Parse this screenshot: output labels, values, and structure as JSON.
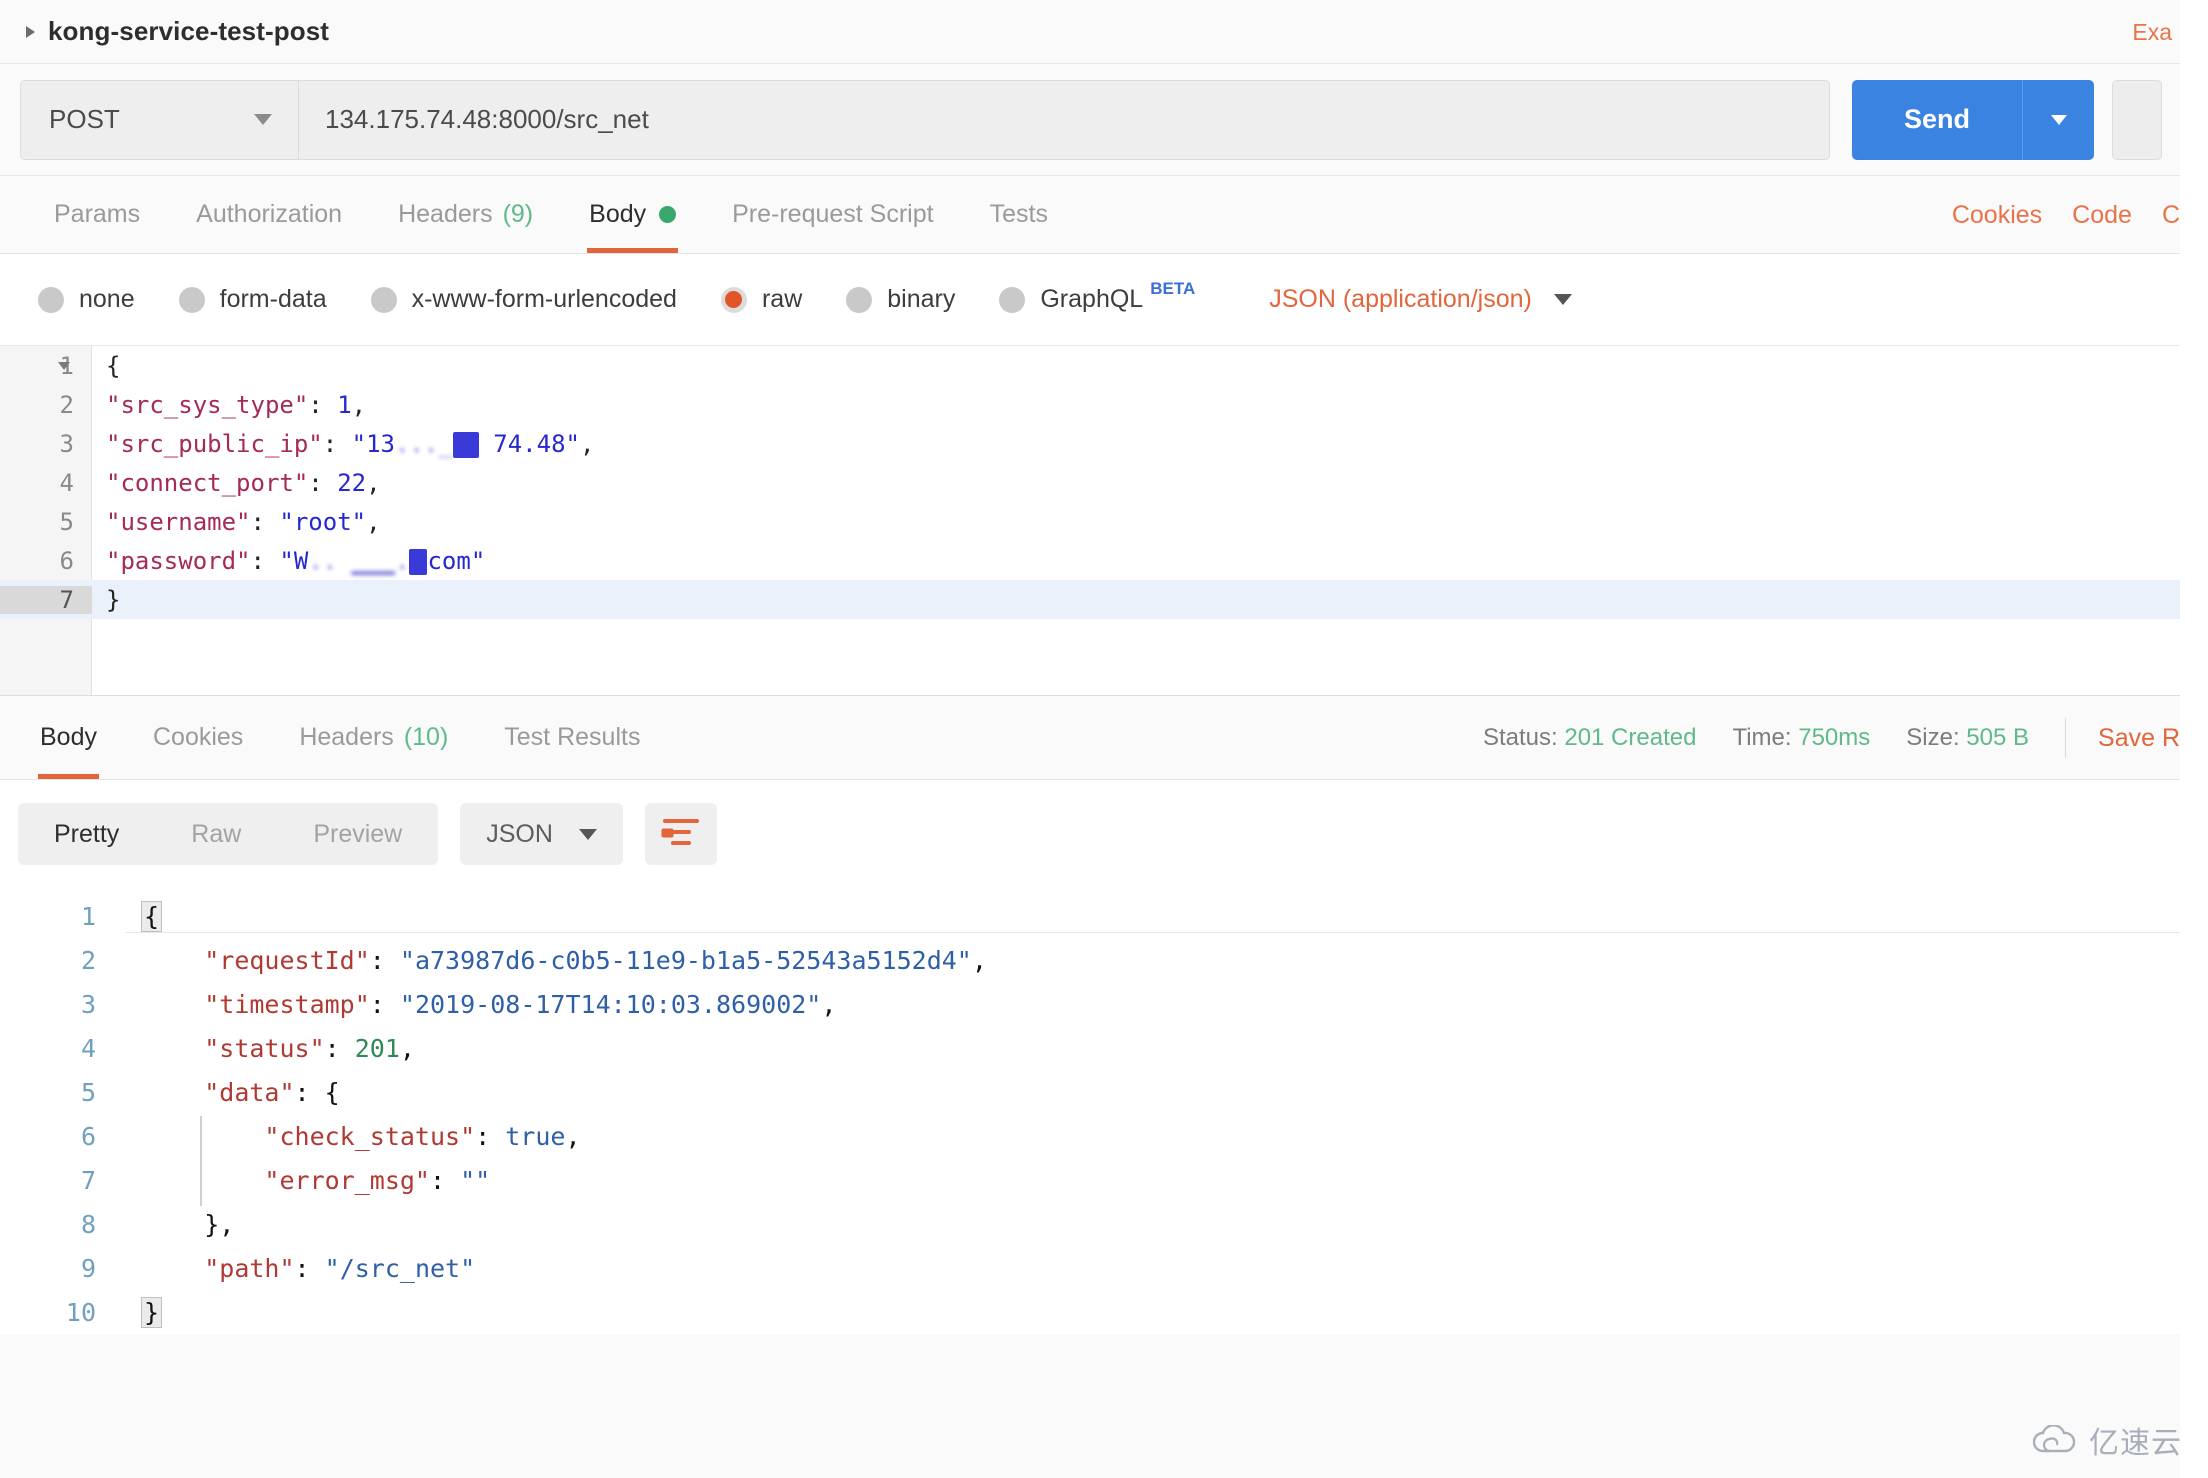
{
  "request": {
    "name": "kong-service-test-post",
    "examples_link": "Exa",
    "method": "POST",
    "url": "134.175.74.48:8000/src_net",
    "send_label": "Send",
    "tabs": [
      {
        "label": "Params",
        "count": "",
        "active": false,
        "dot": false
      },
      {
        "label": "Authorization",
        "count": "",
        "active": false,
        "dot": false
      },
      {
        "label": "Headers",
        "count": "(9)",
        "active": false,
        "dot": false
      },
      {
        "label": "Body",
        "count": "",
        "active": true,
        "dot": true
      },
      {
        "label": "Pre-request Script",
        "count": "",
        "active": false,
        "dot": false
      },
      {
        "label": "Tests",
        "count": "",
        "active": false,
        "dot": false
      }
    ],
    "right_links": [
      "Cookies",
      "Code",
      "C"
    ],
    "body_types": [
      {
        "label": "none",
        "checked": false
      },
      {
        "label": "form-data",
        "checked": false
      },
      {
        "label": "x-www-form-urlencoded",
        "checked": false
      },
      {
        "label": "raw",
        "checked": true
      },
      {
        "label": "binary",
        "checked": false
      },
      {
        "label": "GraphQL",
        "checked": false,
        "badge": "BETA"
      }
    ],
    "content_type": "JSON (application/json)",
    "body_lines": [
      {
        "n": "1",
        "fold": true,
        "highlight": false,
        "text": "{"
      },
      {
        "n": "2",
        "fold": false,
        "highlight": false,
        "key": "\"src_sys_type\"",
        "sep": ": ",
        "val": "1",
        "tail": ","
      },
      {
        "n": "3",
        "fold": false,
        "highlight": false,
        "key": "\"src_public_ip\"",
        "sep": ": ",
        "val": "\"13",
        "redacted": true,
        "val2": "74.48\"",
        "tail": ","
      },
      {
        "n": "4",
        "fold": false,
        "highlight": false,
        "key": "\"connect_port\"",
        "sep": ": ",
        "val": "22",
        "tail": ","
      },
      {
        "n": "5",
        "fold": false,
        "highlight": false,
        "key": "\"username\"",
        "sep": ": ",
        "val": "\"root\"",
        "tail": ","
      },
      {
        "n": "6",
        "fold": false,
        "highlight": false,
        "key": "\"password\"",
        "sep": ": ",
        "val": "\"W",
        "redacted2": true,
        "val2": "com\"",
        "tail": ""
      },
      {
        "n": "7",
        "fold": false,
        "highlight": true,
        "text": "}"
      }
    ]
  },
  "response": {
    "tabs": [
      {
        "label": "Body",
        "count": "",
        "active": true
      },
      {
        "label": "Cookies",
        "count": "",
        "active": false
      },
      {
        "label": "Headers",
        "count": "(10)",
        "active": false
      },
      {
        "label": "Test Results",
        "count": "",
        "active": false
      }
    ],
    "meta": {
      "status_label": "Status:",
      "status_value": "201 Created",
      "time_label": "Time:",
      "time_value": "750ms",
      "size_label": "Size:",
      "size_value": "505 B",
      "save_link": "Save R"
    },
    "toolbar": {
      "segments": [
        {
          "label": "Pretty",
          "active": true
        },
        {
          "label": "Raw",
          "active": false
        },
        {
          "label": "Preview",
          "active": false
        }
      ],
      "format": "JSON",
      "wrap_icon": "word-wrap-icon"
    },
    "body_lines": [
      {
        "n": "1",
        "raw": "{"
      },
      {
        "n": "2",
        "indent": 1,
        "key": "\"requestId\"",
        "val": "\"a73987d6-c0b5-11e9-b1a5-52543a5152d4\"",
        "type": "str",
        "tail": ","
      },
      {
        "n": "3",
        "indent": 1,
        "key": "\"timestamp\"",
        "val": "\"2019-08-17T14:10:03.869002\"",
        "type": "str",
        "tail": ","
      },
      {
        "n": "4",
        "indent": 1,
        "key": "\"status\"",
        "val": "201",
        "type": "num",
        "tail": ","
      },
      {
        "n": "5",
        "indent": 1,
        "key": "\"data\"",
        "val": "{",
        "type": "pun",
        "tail": ""
      },
      {
        "n": "6",
        "indent": 2,
        "key": "\"check_status\"",
        "val": "true",
        "type": "bool",
        "tail": ","
      },
      {
        "n": "7",
        "indent": 2,
        "key": "\"error_msg\"",
        "val": "\"\"",
        "type": "str",
        "tail": ""
      },
      {
        "n": "8",
        "indent": 1,
        "raw": "},"
      },
      {
        "n": "9",
        "indent": 1,
        "key": "\"path\"",
        "val": "\"/src_net\"",
        "type": "str",
        "tail": ""
      },
      {
        "n": "10",
        "indent": 0,
        "raw": "}"
      }
    ]
  },
  "watermark": {
    "text": "亿速云",
    "icon": "cloud-icon"
  },
  "colors": {
    "accent_orange": "#e2653c",
    "send_blue": "#3b83e0",
    "status_green": "#5fb98a",
    "body_dot_green": "#3aa76d"
  }
}
